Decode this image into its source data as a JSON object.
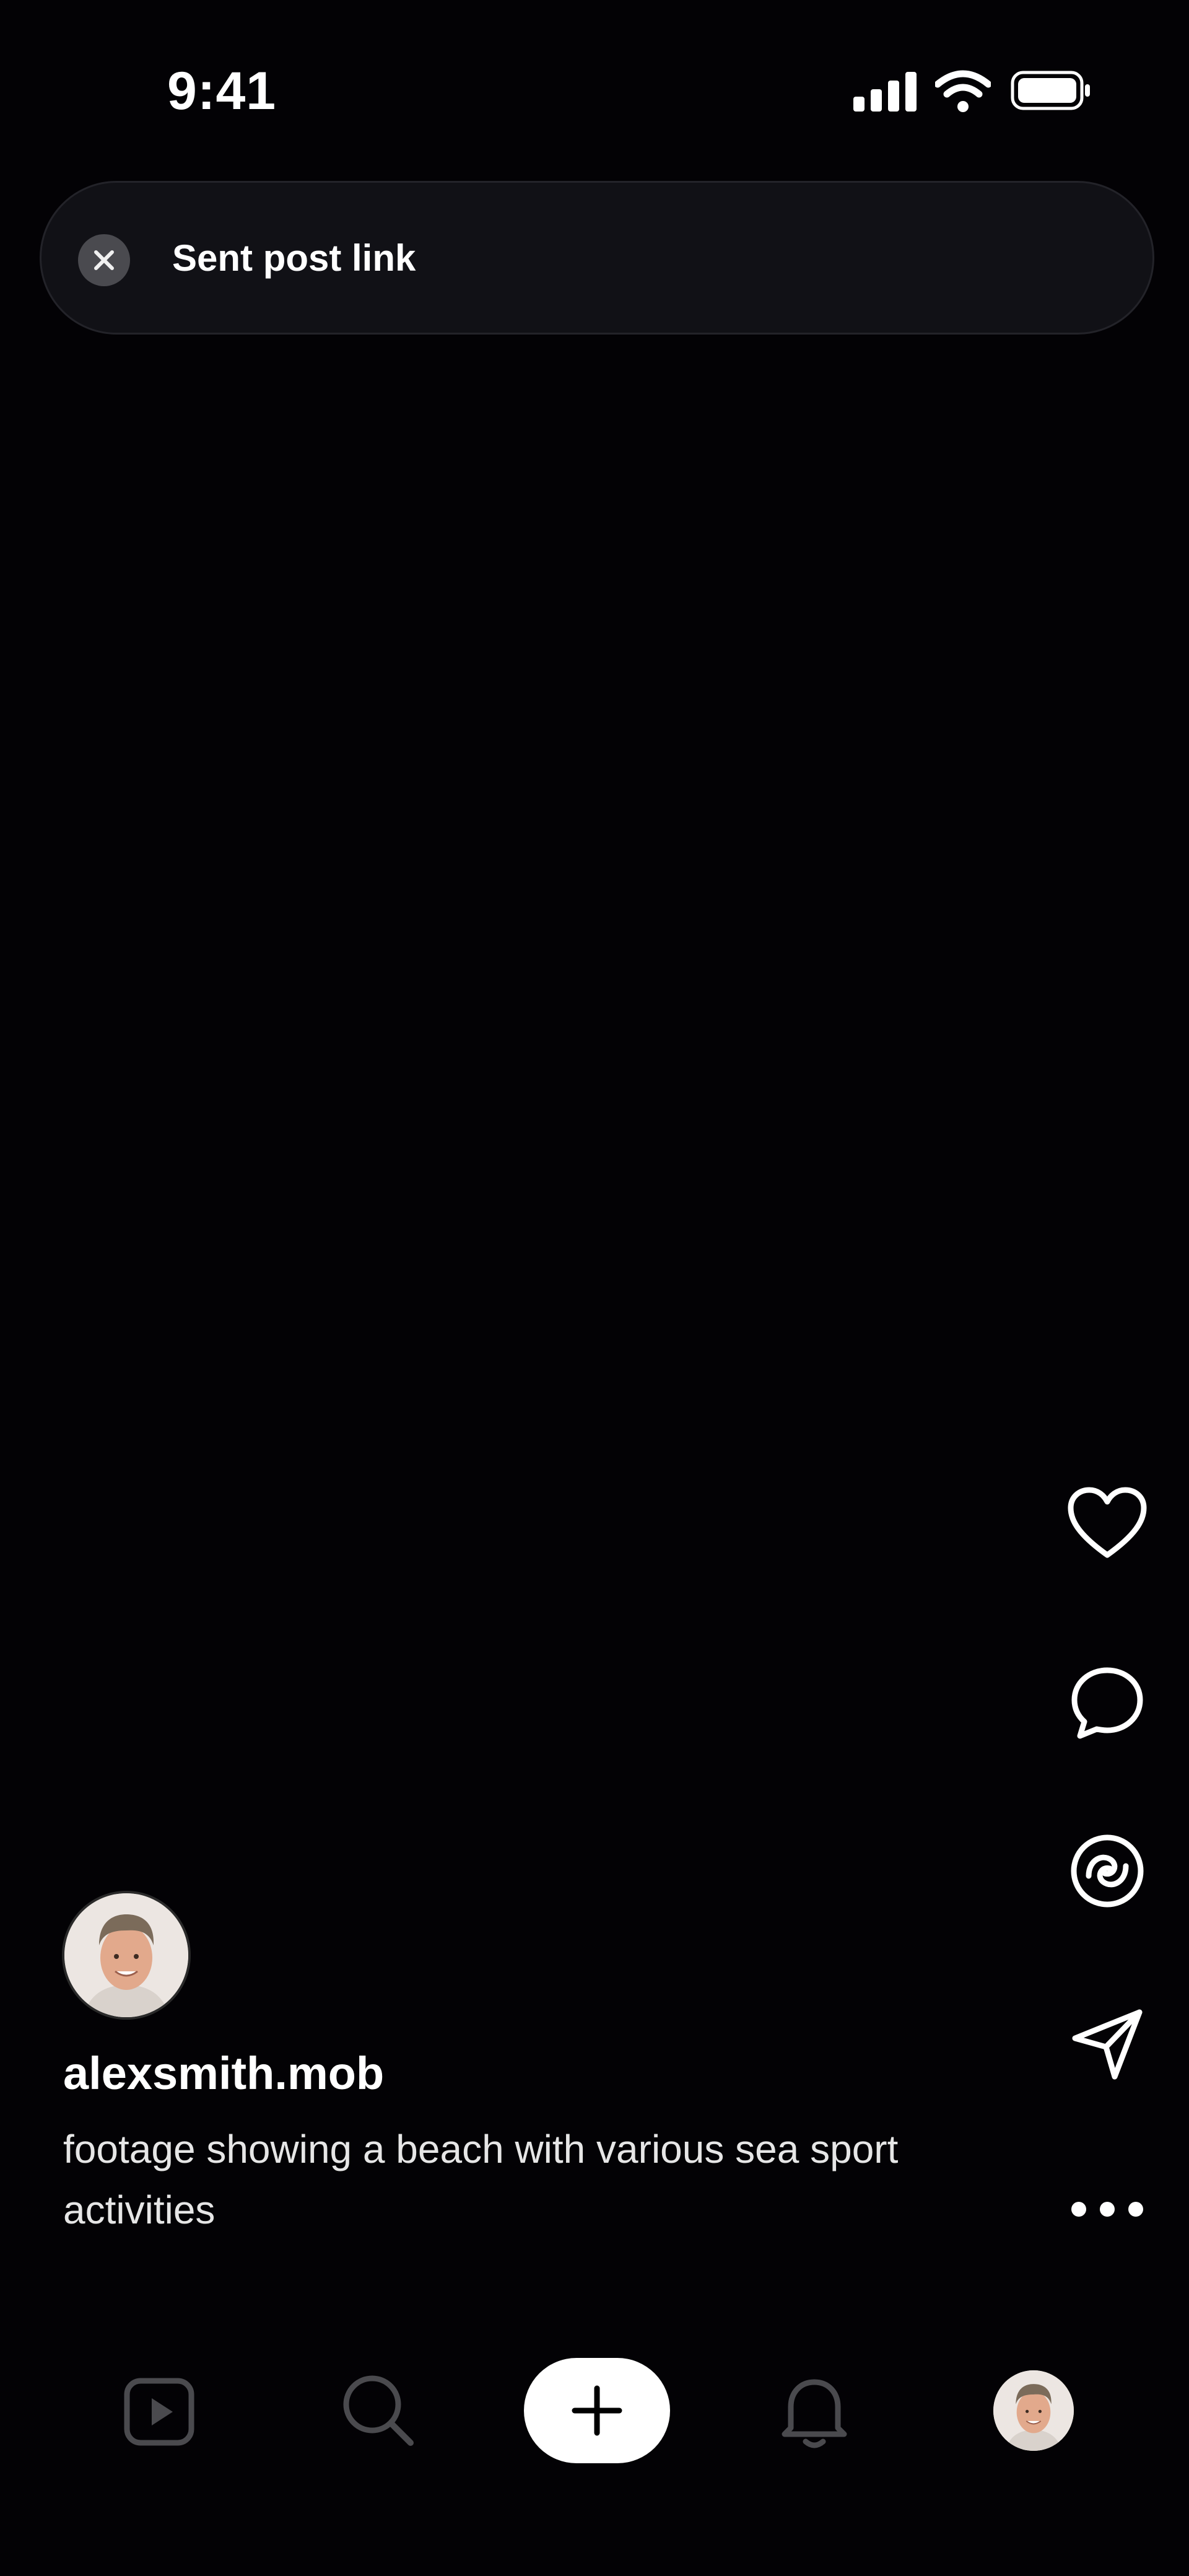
{
  "status_bar": {
    "time": "9:41"
  },
  "toast": {
    "message": "Sent post link"
  },
  "post": {
    "username": "alexsmith.mob",
    "caption": "footage showing a beach with various sea sport activities"
  },
  "rail_icons": [
    "heart-icon",
    "comment-icon",
    "remix-icon",
    "send-icon",
    "more-icon"
  ],
  "nav_icons": [
    "reels-icon",
    "search-icon",
    "plus-icon",
    "bell-icon",
    "profile-avatar"
  ],
  "colors": {
    "background": "#030205",
    "toast_bg": "#111116",
    "text": "#ffffff"
  }
}
